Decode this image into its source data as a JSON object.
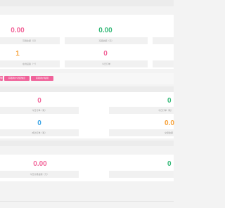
{
  "colors": {
    "pink": "#f2669a",
    "green": "#35b978",
    "orange": "#f7a23a",
    "blue": "#3aa4e6",
    "pill": "#f0629a"
  },
  "section1": {
    "stat1": {
      "value": "0.00",
      "label": "可用余额（元）"
    },
    "stat2": {
      "value": "0.00",
      "label": "冻结余额（元）"
    },
    "stat3": {
      "value": "1",
      "label": "在线设备（个）"
    },
    "stat4": {
      "value": "0",
      "label": "今日订单"
    }
  },
  "actions": {
    "button1": "佣金设置",
    "button2": "获取商户对接信息",
    "button3": "获取商户秘钥"
  },
  "section2": {
    "stat1": {
      "value": "0",
      "label": "今日订单（笔）"
    },
    "stat2": {
      "value": "0",
      "label": "今日订单（笔）"
    },
    "stat3": {
      "value": "0",
      "label": "成功订单（笔）"
    },
    "stat4": {
      "value": "0.0",
      "label": "交易金额"
    }
  },
  "section3": {
    "stat1": {
      "value": "0.00",
      "label": "今日交易金额（元）"
    },
    "stat2": {
      "value": "0",
      "label": ""
    }
  }
}
